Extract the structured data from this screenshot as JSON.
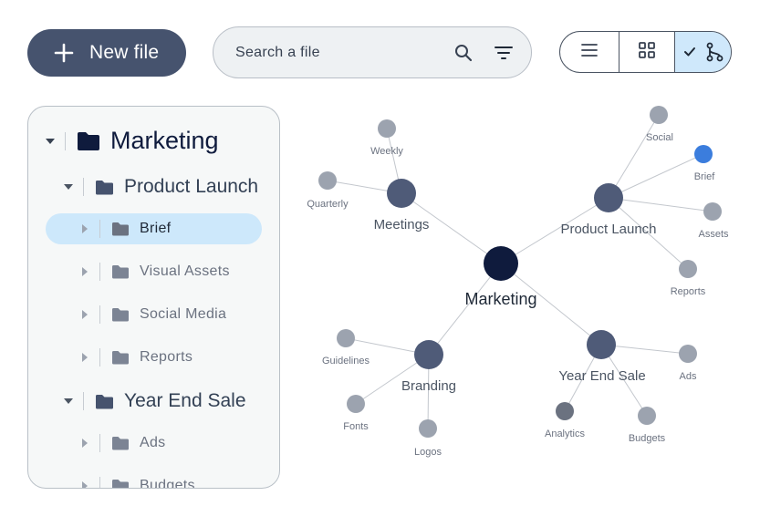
{
  "toolbar": {
    "new_file_label": "New file",
    "search_placeholder": "Search a file"
  },
  "view_options": [
    "list-view",
    "grid-view",
    "graph-view"
  ],
  "selected_view": "graph-view",
  "tree": {
    "root": "Marketing",
    "groups": [
      {
        "label": "Product Launch",
        "expanded": true,
        "children": [
          "Brief",
          "Visual Assets",
          "Social Media",
          "Reports"
        ]
      },
      {
        "label": "Year End Sale",
        "expanded": true,
        "children": [
          "Ads",
          "Budgets"
        ]
      }
    ],
    "selected": "Brief"
  },
  "graph": {
    "center": "Marketing",
    "hubs": [
      "Meetings",
      "Product Launch",
      "Branding",
      "Year End Sale"
    ],
    "leaves": {
      "meetings": [
        "Weekly",
        "Quarterly"
      ],
      "product_launch": [
        "Social",
        "Brief",
        "Assets",
        "Reports"
      ],
      "branding": [
        "Guidelines",
        "Fonts",
        "Logos"
      ],
      "year_end_sale": [
        "Ads",
        "Analytics",
        "Budgets"
      ]
    },
    "colors": {
      "center": "#0f1b3d",
      "hub": "#4f5b78",
      "leaf": "#9ca3af",
      "leaf_dark": "#6b7280",
      "highlight": "#3b7ddd"
    }
  }
}
